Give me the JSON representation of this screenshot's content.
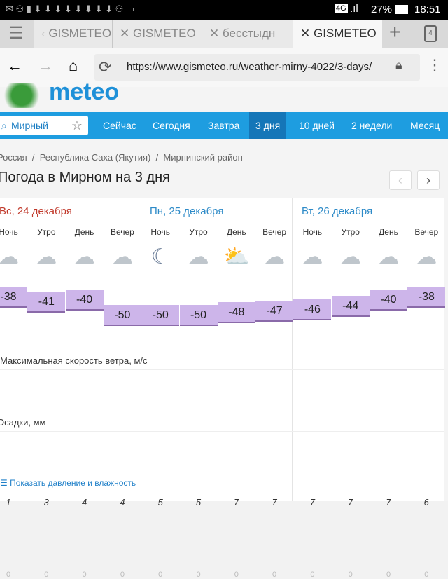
{
  "status": {
    "network": "4G",
    "battery": "27%",
    "time": "18:51"
  },
  "browser": {
    "tabs": [
      "GISMETEO",
      "GISMETEO",
      "бесстыдн",
      "GISMETEO"
    ],
    "tab_count": "4",
    "url": "https://www.gismeteo.ru/weather-mirny-4022/3-days/"
  },
  "site": {
    "logo": "meteo",
    "search_value": "Мирный",
    "nav": [
      "Сейчас",
      "Сегодня",
      "Завтра",
      "3 дня",
      "10 дней",
      "2 недели",
      "Месяц"
    ],
    "breadcrumbs": [
      "Россия",
      "Республика Саха (Якутия)",
      "Мирнинский район"
    ],
    "title": "Погода в Мирном на 3 дня",
    "days": [
      "Вс, 24 декабря",
      "Пн, 25 декабря",
      "Вт, 26 декабря"
    ],
    "periods": [
      "Ночь",
      "Утро",
      "День",
      "Вечер",
      "Ночь",
      "Утро",
      "День",
      "Вечер",
      "Ночь",
      "Утро",
      "День",
      "Вечер"
    ],
    "icons": [
      "cloudy-night",
      "cloudy-night",
      "cloudy",
      "cloudy-night",
      "clear-night",
      "cloudy-night",
      "partly-sunny",
      "cloudy-night",
      "cloudy-night",
      "cloudy-night",
      "cloudy",
      "cloudy-night"
    ],
    "temps": [
      -38,
      -41,
      -40,
      -50,
      -50,
      -50,
      -48,
      -47,
      -46,
      -44,
      -40,
      -38
    ],
    "wind_label": "Максимальная скорость ветра, м/с",
    "wind": [
      1,
      3,
      4,
      4,
      5,
      5,
      7,
      7,
      7,
      7,
      7,
      6
    ],
    "precip_label": "Осадки, мм",
    "precip": [
      0,
      0,
      0,
      0,
      0,
      0,
      0,
      0,
      0,
      0,
      0,
      0
    ],
    "more_link": "Показать давление и влажность",
    "colors": {
      "sunday": "#c0392b",
      "weekday": "#2e8bc8",
      "nav": "#1e9de0",
      "temp_band": "#cdb5ea"
    }
  }
}
